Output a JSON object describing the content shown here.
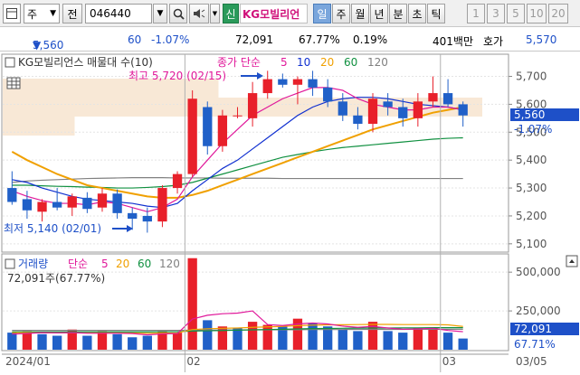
{
  "toolbar": {
    "market_type": "주",
    "previous_label": "전",
    "code_value": "046440",
    "credit_badge": "신",
    "stock_name": "KG모빌리언",
    "period_tabs": [
      "일",
      "주",
      "월",
      "년",
      "분",
      "초",
      "틱"
    ],
    "active_period": "일",
    "interval_buttons": [
      "1",
      "3",
      "5",
      "10",
      "20"
    ]
  },
  "quote": {
    "price": "5,560",
    "direction": "▼",
    "change": "60",
    "change_pct": "-1.07%",
    "volume": "72,091",
    "volume_ratio": "67.77%",
    "turnover": "0.19%",
    "amount": "401백만",
    "ask_label": "호가",
    "ask_price": "5,570"
  },
  "price_panel": {
    "title": "KG모빌리언스 매물대 수(10)",
    "ma_title": "종가 단순",
    "ma_periods": [
      "5",
      "10",
      "20",
      "60",
      "120"
    ],
    "ma_colors": [
      "#e0189a",
      "#1030d0",
      "#f0a000",
      "#109040",
      "#808080"
    ],
    "high_label": "최고 5,720 (02/15)",
    "low_label": "최저 5,140 (02/01)",
    "y_ticks": [
      "5,700",
      "5,600",
      "5,500",
      "5,400",
      "5,300",
      "5,200",
      "5,100"
    ],
    "current_price_tag": "5,560",
    "current_pct_tag": "-1.07%"
  },
  "volume_panel": {
    "title": "거래량",
    "ma_title": "단순",
    "ma_periods": [
      "5",
      "20",
      "60",
      "120"
    ],
    "ma_colors": [
      "#e0189a",
      "#f0a000",
      "#109040",
      "#808080"
    ],
    "current_value_label": "72,091주(67.77%)",
    "y_ticks": [
      "500,000",
      "250,000"
    ],
    "current_volume_tag": "72,091",
    "current_pct_tag": "67.71%"
  },
  "x_axis": {
    "labels": [
      "2024/01",
      "02",
      "03"
    ],
    "right_label": "03/05"
  },
  "colors": {
    "up": "#e8202a",
    "down": "#2060c8",
    "accent": "#3c78c8"
  },
  "chart_data": {
    "type": "candlestick",
    "price_ylim": [
      5080,
      5760
    ],
    "volume_ylim": [
      0,
      600000
    ],
    "candles": [
      {
        "o": 5300,
        "h": 5360,
        "l": 5240,
        "c": 5250
      },
      {
        "o": 5260,
        "h": 5290,
        "l": 5190,
        "c": 5220
      },
      {
        "o": 5215,
        "h": 5260,
        "l": 5180,
        "c": 5250
      },
      {
        "o": 5250,
        "h": 5300,
        "l": 5220,
        "c": 5230
      },
      {
        "o": 5230,
        "h": 5280,
        "l": 5200,
        "c": 5270
      },
      {
        "o": 5265,
        "h": 5285,
        "l": 5210,
        "c": 5225
      },
      {
        "o": 5230,
        "h": 5300,
        "l": 5215,
        "c": 5280
      },
      {
        "o": 5280,
        "h": 5295,
        "l": 5190,
        "c": 5210
      },
      {
        "o": 5210,
        "h": 5230,
        "l": 5150,
        "c": 5190
      },
      {
        "o": 5200,
        "h": 5230,
        "l": 5140,
        "c": 5180
      },
      {
        "o": 5180,
        "h": 5310,
        "l": 5160,
        "c": 5300
      },
      {
        "o": 5300,
        "h": 5360,
        "l": 5280,
        "c": 5350
      },
      {
        "o": 5350,
        "h": 5650,
        "l": 5340,
        "c": 5620
      },
      {
        "o": 5590,
        "h": 5610,
        "l": 5420,
        "c": 5450
      },
      {
        "o": 5450,
        "h": 5580,
        "l": 5430,
        "c": 5560
      },
      {
        "o": 5560,
        "h": 5590,
        "l": 5550,
        "c": 5560
      },
      {
        "o": 5550,
        "h": 5680,
        "l": 5520,
        "c": 5640
      },
      {
        "o": 5640,
        "h": 5720,
        "l": 5620,
        "c": 5690
      },
      {
        "o": 5690,
        "h": 5710,
        "l": 5660,
        "c": 5670
      },
      {
        "o": 5670,
        "h": 5700,
        "l": 5600,
        "c": 5690
      },
      {
        "o": 5690,
        "h": 5720,
        "l": 5630,
        "c": 5660
      },
      {
        "o": 5660,
        "h": 5690,
        "l": 5590,
        "c": 5610
      },
      {
        "o": 5610,
        "h": 5640,
        "l": 5540,
        "c": 5560
      },
      {
        "o": 5560,
        "h": 5590,
        "l": 5510,
        "c": 5530
      },
      {
        "o": 5530,
        "h": 5640,
        "l": 5500,
        "c": 5620
      },
      {
        "o": 5610,
        "h": 5640,
        "l": 5560,
        "c": 5590
      },
      {
        "o": 5590,
        "h": 5620,
        "l": 5520,
        "c": 5550
      },
      {
        "o": 5550,
        "h": 5640,
        "l": 5520,
        "c": 5610
      },
      {
        "o": 5610,
        "h": 5700,
        "l": 5590,
        "c": 5640
      },
      {
        "o": 5640,
        "h": 5690,
        "l": 5590,
        "c": 5600
      },
      {
        "o": 5600,
        "h": 5610,
        "l": 5520,
        "c": 5560
      }
    ],
    "volumes": [
      110000,
      120000,
      100000,
      90000,
      130000,
      90000,
      120000,
      100000,
      80000,
      90000,
      120000,
      110000,
      590000,
      190000,
      150000,
      140000,
      180000,
      160000,
      150000,
      200000,
      170000,
      150000,
      130000,
      120000,
      180000,
      120000,
      110000,
      140000,
      140000,
      110000,
      72091
    ],
    "volume_up_flags": [
      false,
      true,
      false,
      false,
      true,
      false,
      true,
      false,
      false,
      false,
      true,
      true,
      true,
      false,
      true,
      false,
      true,
      true,
      false,
      true,
      false,
      false,
      false,
      false,
      true,
      false,
      false,
      true,
      true,
      false,
      false
    ],
    "ma5": [
      5290,
      5270,
      5255,
      5245,
      5245,
      5240,
      5250,
      5245,
      5230,
      5215,
      5230,
      5260,
      5340,
      5400,
      5460,
      5510,
      5560,
      5590,
      5620,
      5640,
      5660,
      5660,
      5650,
      5620,
      5600,
      5590,
      5580,
      5580,
      5590,
      5590,
      5580
    ],
    "ma10": [
      5330,
      5320,
      5300,
      5285,
      5270,
      5260,
      5255,
      5250,
      5245,
      5235,
      5230,
      5245,
      5290,
      5330,
      5370,
      5400,
      5440,
      5480,
      5520,
      5560,
      5590,
      5610,
      5620,
      5625,
      5625,
      5620,
      5610,
      5600,
      5595,
      5590,
      5580
    ],
    "ma20": [
      5430,
      5400,
      5375,
      5350,
      5330,
      5310,
      5300,
      5290,
      5280,
      5270,
      5265,
      5265,
      5275,
      5290,
      5310,
      5330,
      5350,
      5370,
      5390,
      5410,
      5430,
      5450,
      5470,
      5490,
      5510,
      5525,
      5540,
      5555,
      5570,
      5580,
      5590
    ],
    "ma60": [
      5310,
      5310,
      5308,
      5306,
      5305,
      5303,
      5302,
      5300,
      5300,
      5302,
      5305,
      5310,
      5320,
      5335,
      5350,
      5365,
      5380,
      5395,
      5410,
      5420,
      5430,
      5438,
      5445,
      5450,
      5455,
      5460,
      5465,
      5470,
      5475,
      5478,
      5480
    ],
    "ma120": [
      5320,
      5325,
      5328,
      5330,
      5332,
      5334,
      5335,
      5336,
      5337,
      5337,
      5337,
      5336,
      5336,
      5336,
      5335,
      5335,
      5335,
      5335,
      5334,
      5334,
      5334,
      5334,
      5334,
      5334,
      5334,
      5334,
      5334,
      5334,
      5334,
      5334,
      5334
    ],
    "vol_ma5": [
      100000,
      105000,
      110000,
      108000,
      110000,
      106000,
      106000,
      106000,
      104000,
      96000,
      102000,
      104000,
      198000,
      222000,
      232000,
      236000,
      250000,
      162000,
      156000,
      166000,
      172000,
      166000,
      152000,
      144000,
      150000,
      140000,
      132000,
      134000,
      138000,
      124000,
      116000
    ],
    "vol_ma20": [
      110000,
      110000,
      109000,
      108000,
      108000,
      108000,
      108000,
      108000,
      107000,
      106000,
      107000,
      108000,
      130000,
      135000,
      138000,
      140000,
      144000,
      147000,
      150000,
      155000,
      158000,
      160000,
      161000,
      162000,
      163000,
      163000,
      162000,
      162000,
      162000,
      160000,
      150000
    ],
    "vol_ma60": [
      115000,
      115000,
      115000,
      115000,
      115000,
      115000,
      115000,
      115000,
      115000,
      115000,
      116000,
      116000,
      120000,
      122000,
      124000,
      126000,
      128000,
      130000,
      132000,
      134000,
      136000,
      137000,
      138000,
      139000,
      140000,
      140000,
      141000,
      141000,
      142000,
      142000,
      142000
    ],
    "vol_ma120": [
      125000,
      125000,
      125000,
      125000,
      125000,
      125000,
      125000,
      125000,
      125000,
      125000,
      125000,
      125000,
      126000,
      126000,
      127000,
      127000,
      128000,
      128000,
      129000,
      129000,
      130000,
      130000,
      130000,
      131000,
      131000,
      131000,
      131000,
      132000,
      132000,
      132000,
      132000
    ],
    "volume_profile": [
      0.0,
      0.0,
      0.0,
      0.0,
      0.0,
      0.0,
      0.15,
      1.0,
      0.45,
      0.0
    ]
  }
}
